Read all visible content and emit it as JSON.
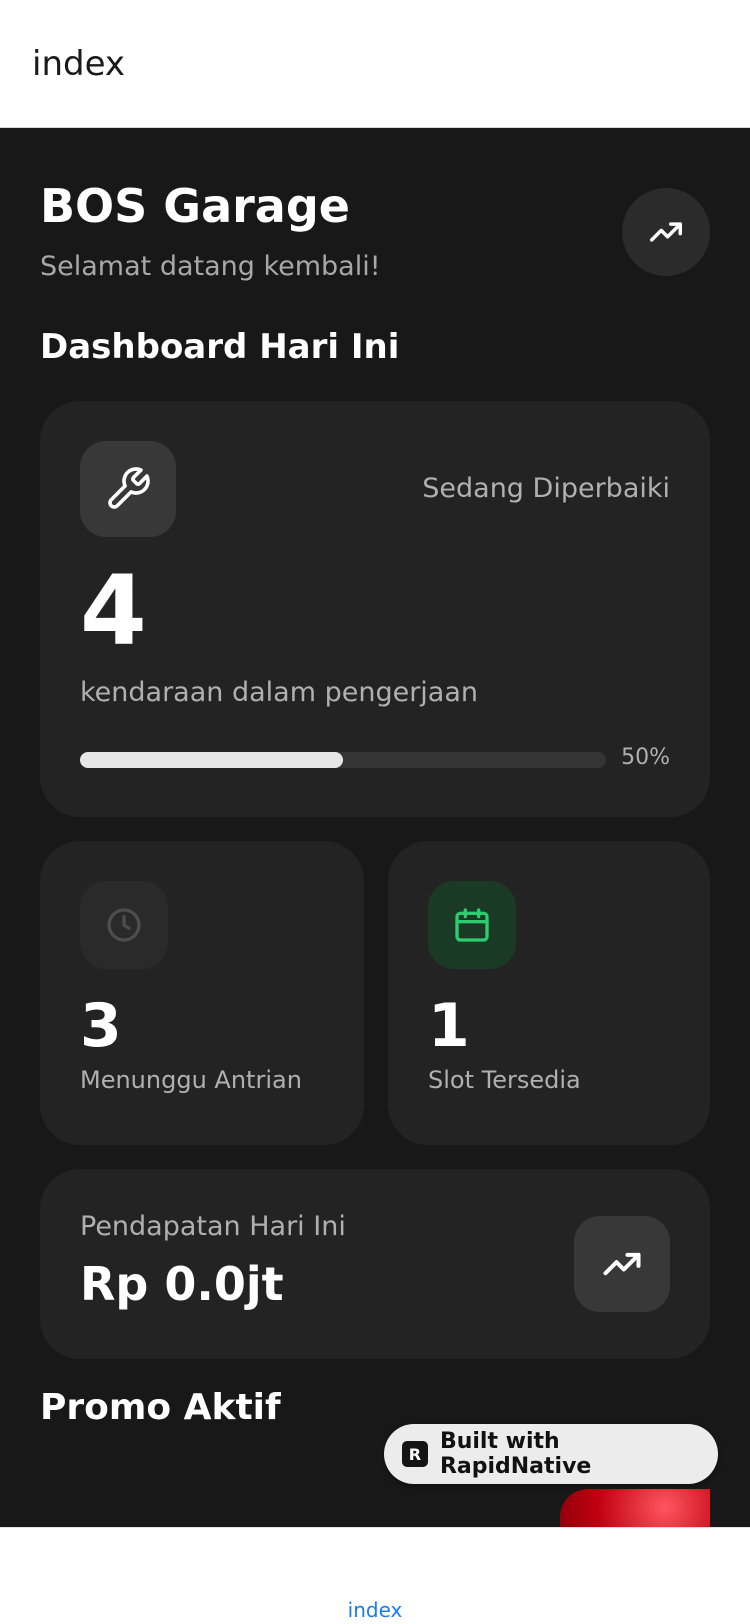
{
  "header": {
    "title": "index"
  },
  "app": {
    "title": "BOS Garage",
    "subtitle": "Selamat datang kembali!"
  },
  "dashboard": {
    "title": "Dashboard Hari Ini",
    "repair": {
      "label": "Sedang Diperbaiki",
      "value": "4",
      "description": "kendaraan dalam pengerjaan",
      "progress": 50,
      "progress_label": "50%",
      "icon": "wrench-icon"
    },
    "queue": {
      "value": "3",
      "label": "Menunggu Antrian",
      "icon": "clock-icon"
    },
    "slots": {
      "value": "1",
      "label": "Slot Tersedia",
      "icon": "calendar-icon",
      "accent": "#2ecc71"
    },
    "revenue": {
      "label": "Pendapatan Hari Ini",
      "value": "Rp 0.0jt",
      "icon": "trending-up-icon"
    }
  },
  "promo": {
    "title": "Promo Aktif"
  },
  "badge": {
    "logo": "R",
    "text": "Built with RapidNative"
  },
  "tabbar": {
    "tabs": [
      {
        "label": "index"
      }
    ]
  },
  "colors": {
    "background": "#181818",
    "card": "#232323",
    "accent_green": "#2ecc71",
    "tab_active": "#1a7cf0"
  }
}
